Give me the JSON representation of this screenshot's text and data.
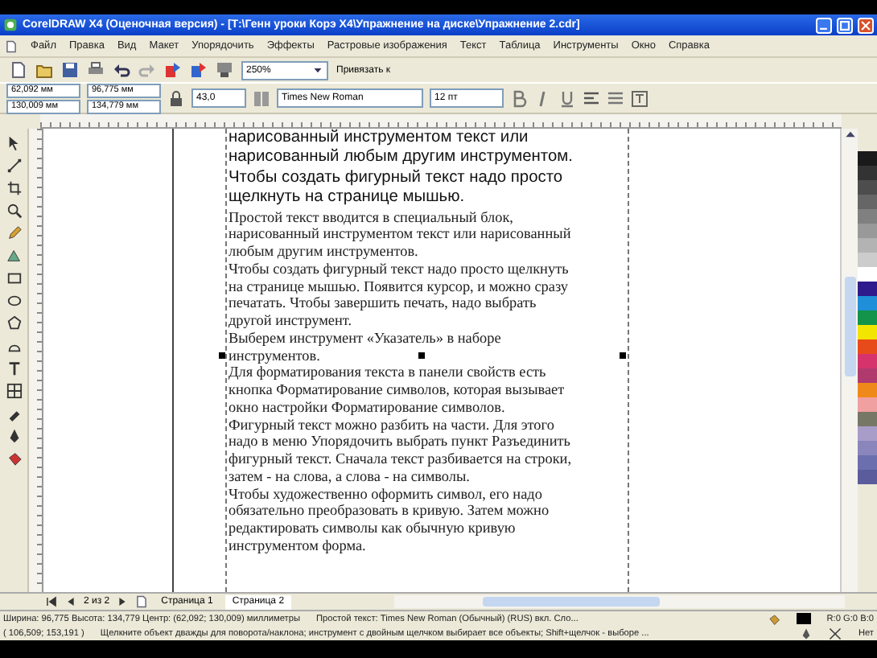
{
  "window": {
    "title": "CorelDRAW X4 (Оценочная версия) - [Т:\\Генн уроки Корэ X4\\Упражнение на диске\\Упражнение 2.cdr]"
  },
  "menu": [
    "Файл",
    "Правка",
    "Вид",
    "Макет",
    "Упорядочить",
    "Эффекты",
    "Растровые изображения",
    "Текст",
    "Таблица",
    "Инструменты",
    "Окно",
    "Справка"
  ],
  "toolbar": {
    "zoom": "250%",
    "snap": "Привязать к"
  },
  "property_bar": {
    "x": "62,092 мм",
    "y": "130,009 мм",
    "width": "96,775 мм",
    "height": "134,779 мм",
    "angle": "43,0",
    "font": "Times New Roman",
    "font_size": "12 пт"
  },
  "document": {
    "heading_lines": [
      "нарисованный инструментом текст или",
      "нарисованный любым другим инструментом.",
      "Чтобы создать фигурный текст надо просто",
      "щелкнуть на странице мышью."
    ],
    "body_lines": [
      "Простой текст вводится в специальный блок,",
      "нарисованный инструментом текст или нарисованный",
      "любым другим инструментов.",
      "Чтобы создать фигурный текст надо просто щелкнуть",
      "на странице мышью. Появится курсор, и можно сразу",
      "печатать. Чтобы завершить печать, надо выбрать",
      "другой инструмент.",
      "Выберем инструмент «Указатель» в наборе",
      "инструментов.",
      "Для форматирования текста в панели свойств есть",
      "кнопка Форматирование символов, которая вызывает",
      "окно настройки Форматирование символов.",
      "Фигурный текст можно разбить на части. Для этого",
      "надо в меню Упорядочить выбрать пункт Разъединить",
      "фигурный текст. Сначала текст разбивается на строки,",
      "затем - на слова, а слова - на символы.",
      "Чтобы художественно оформить символ, его надо",
      "обязательно преобразовать в кривую. Затем можно",
      "редактировать символы как обычную кривую",
      "инструментом форма."
    ]
  },
  "page_nav": {
    "counter": "2 из 2",
    "tabs": [
      {
        "label": "Страница 1",
        "selected": false
      },
      {
        "label": "Страница 2",
        "selected": true
      }
    ]
  },
  "palette": [
    {
      "color": "#1a1a1a"
    },
    {
      "color": "#333333"
    },
    {
      "color": "#4d4d4d"
    },
    {
      "color": "#666666"
    },
    {
      "color": "#808080"
    },
    {
      "color": "#999999"
    },
    {
      "color": "#b3b3b3"
    },
    {
      "color": "#cccccc"
    },
    {
      "color": "#ffffff"
    },
    {
      "color": "#2e1a8c"
    },
    {
      "color": "#1e8fd8"
    },
    {
      "color": "#13944a"
    },
    {
      "color": "#f2e600"
    },
    {
      "color": "#e84b1a"
    },
    {
      "color": "#d6336c"
    },
    {
      "color": "#b03a6e"
    },
    {
      "color": "#ef8a1a"
    },
    {
      "color": "#f0a0a0"
    },
    {
      "color": "#777766"
    },
    {
      "color": "#a89cc8"
    },
    {
      "color": "#8a86bb"
    },
    {
      "color": "#6b6fae"
    },
    {
      "color": "#5a5c9c"
    }
  ],
  "status_bar": {
    "dimensions": "Ширина: 96,775 Высота: 134,779 Центр: (62,092; 130,009) миллиметры",
    "object_info": "Простой текст: Times New Roman (Обычный) (RUS) вкл. Сло...",
    "fill": "R:0 G:0 B:0",
    "cursor": "( 106,509; 153,191 )",
    "hint": "Щелкните объект дважды для поворота/наклона; инструмент с двойным щелчком выбирает все объекты; Shift+щелчок - выборе ...",
    "outline": "Нет"
  }
}
